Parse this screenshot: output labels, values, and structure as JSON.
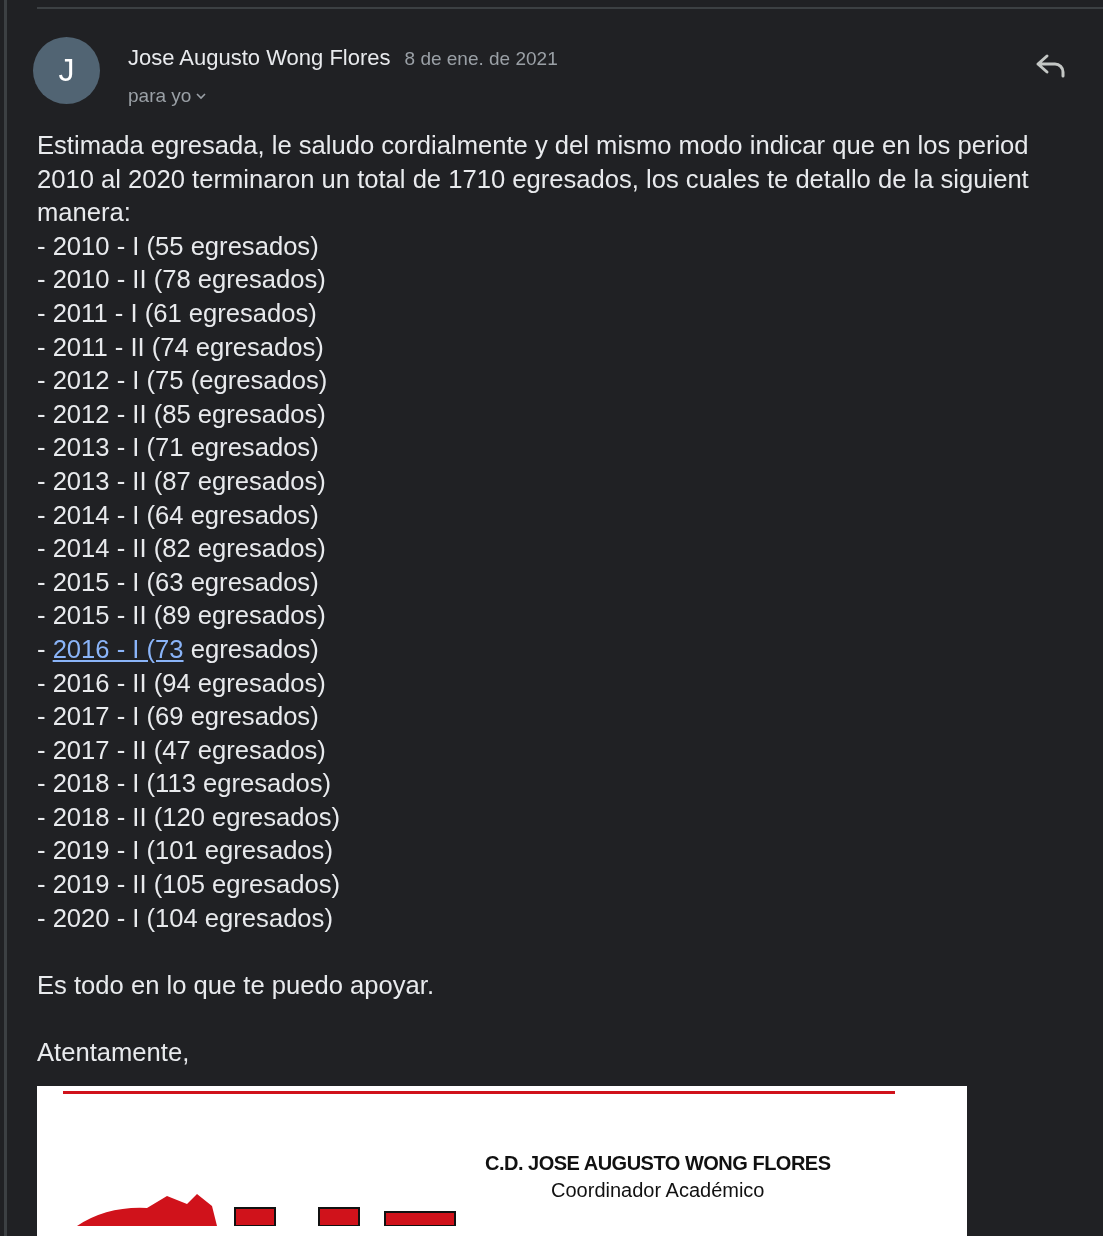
{
  "message": {
    "avatar_letter": "J",
    "sender": "Jose Augusto Wong Flores",
    "date": "8 de ene. de 2021",
    "recipient": "para yo"
  },
  "intro_lines": [
    "Estimada egresada, le saludo cordialmente y del mismo modo indicar que en los period",
    "2010 al 2020 terminaron un total de 1710 egresados, los cuales te detallo de la siguient",
    "manera:"
  ],
  "items": [
    {
      "kind": "plain",
      "text": "- 2010 - I (55 egresados)"
    },
    {
      "kind": "plain",
      "text": "- 2010 - II (78 egresados)"
    },
    {
      "kind": "plain",
      "text": "- 2011 - I (61 egresados)"
    },
    {
      "kind": "plain",
      "text": "- 2011 - II (74 egresados)"
    },
    {
      "kind": "plain",
      "text": "- 2012 - I (75 (egresados)"
    },
    {
      "kind": "plain",
      "text": "- 2012 - II (85 egresados)"
    },
    {
      "kind": "plain",
      "text": "- 2013 - I (71 egresados)"
    },
    {
      "kind": "plain",
      "text": "- 2013 - II (87 egresados)"
    },
    {
      "kind": "plain",
      "text": "- 2014 - I (64 egresados)"
    },
    {
      "kind": "plain",
      "text": "- 2014 - II (82 egresados)"
    },
    {
      "kind": "plain",
      "text": "- 2015 - I (63 egresados)"
    },
    {
      "kind": "plain",
      "text": "- 2015 - II (89 egresados)"
    },
    {
      "kind": "link",
      "before": "- ",
      "link": "2016 - I (73",
      "after": " egresados)"
    },
    {
      "kind": "plain",
      "text": "- 2016 - II (94 egresados)"
    },
    {
      "kind": "plain",
      "text": "- 2017 - I (69 egresados)"
    },
    {
      "kind": "plain",
      "text": "- 2017 - II (47 egresados)"
    },
    {
      "kind": "plain",
      "text": "- 2018 - I (113 egresados)"
    },
    {
      "kind": "plain",
      "text": "- 2018 - II (120 egresados)"
    },
    {
      "kind": "plain",
      "text": "- 2019 - I (101 egresados)"
    },
    {
      "kind": "plain",
      "text": "- 2019 - II (105 egresados)"
    },
    {
      "kind": "plain",
      "text": "- 2020 - I (104 egresados)"
    }
  ],
  "closing": "Es todo en lo que te puedo apoyar.",
  "signoff": "Atentamente,",
  "signature": {
    "name": "C.D.  JOSE AUGUSTO WONG FLORES",
    "role": "Coordinador Académico"
  }
}
